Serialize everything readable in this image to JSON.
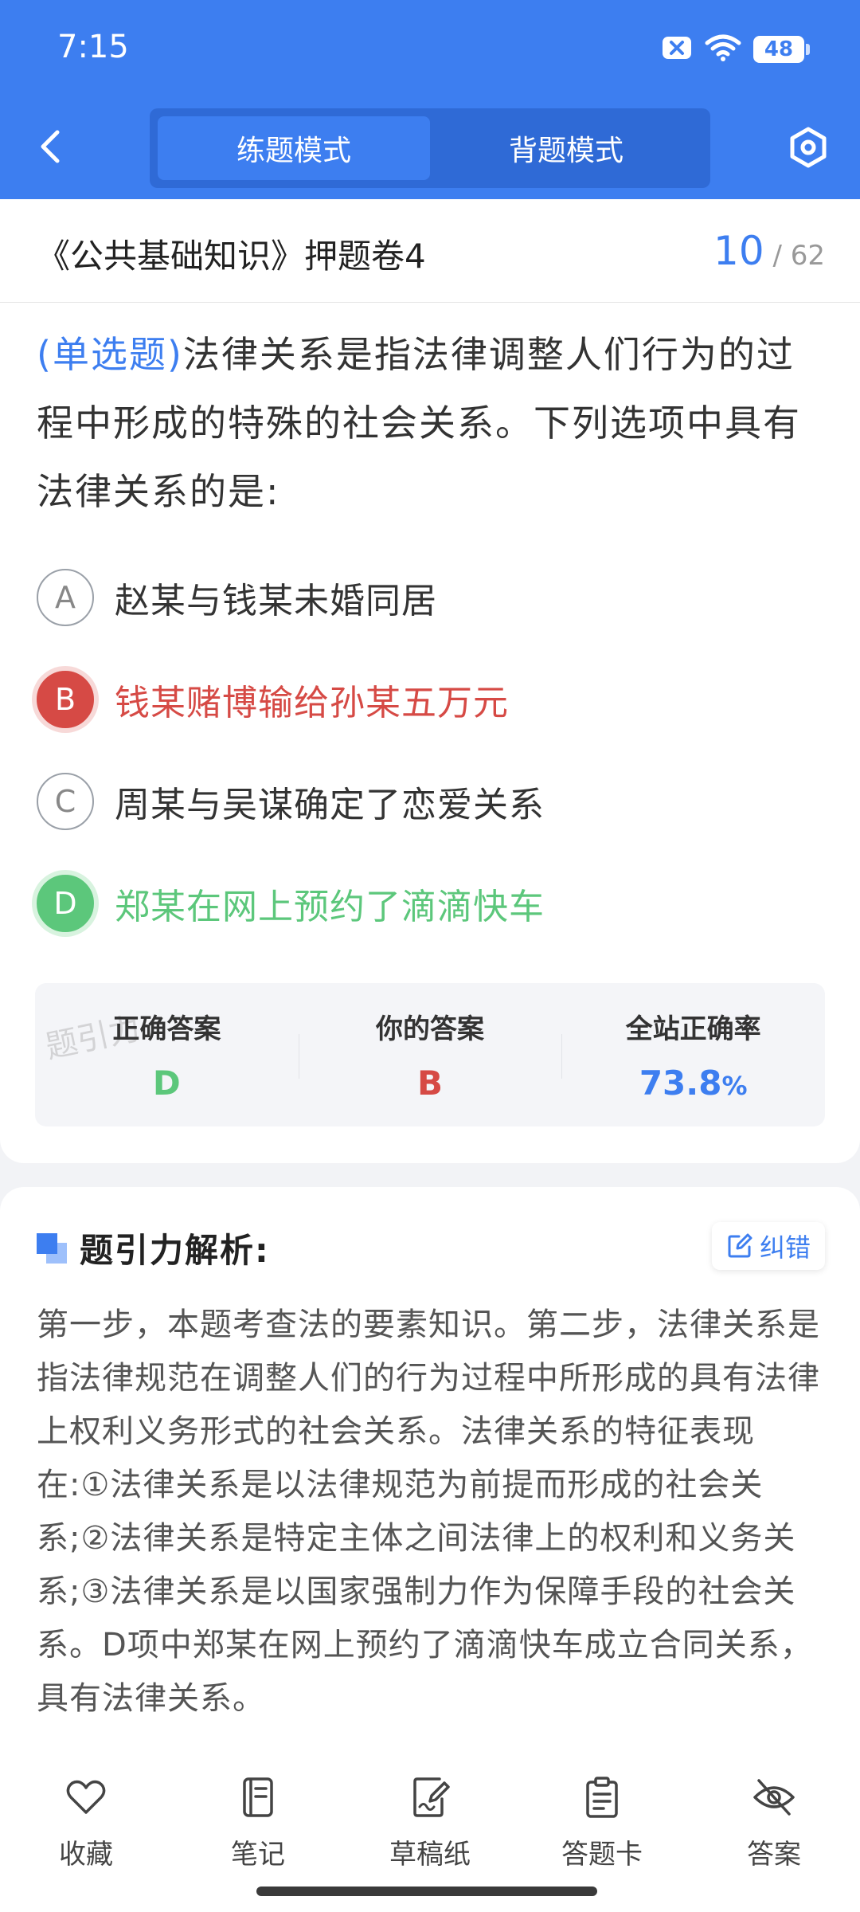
{
  "status": {
    "time": "7:15",
    "battery": "48"
  },
  "header": {
    "modes": [
      "练题模式",
      "背题模式"
    ],
    "active_mode": "练题模式"
  },
  "title_bar": {
    "paper_title": "《公共基础知识》押题卷4",
    "current": "10",
    "separator": "/",
    "total": "62"
  },
  "question": {
    "type": "(单选题)",
    "text": "法律关系是指法律调整人们行为的过程中形成的特殊的社会关系。下列选项中具有法律关系的是:",
    "options": [
      {
        "letter": "A",
        "text": "赵某与钱某未婚同居",
        "state": "normal"
      },
      {
        "letter": "B",
        "text": "钱某赌博输给孙某五万元",
        "state": "wrong"
      },
      {
        "letter": "C",
        "text": "周某与吴谋确定了恋爱关系",
        "state": "normal"
      },
      {
        "letter": "D",
        "text": "郑某在网上预约了滴滴快车",
        "state": "correct"
      }
    ]
  },
  "answers": {
    "correct_label": "正确答案",
    "correct_value": "D",
    "yours_label": "你的答案",
    "yours_value": "B",
    "rate_label": "全站正确率",
    "rate_value": "73.8",
    "rate_unit": "%",
    "watermark": "题引力"
  },
  "analysis": {
    "title": "题引力解析:",
    "report_label": "纠错",
    "text": "第一步，本题考查法的要素知识。第二步，法律关系是指法律规范在调整人们的行为过程中所形成的具有法律上权利义务形式的社会关系。法律关系的特征表现在:①法律关系是以法律规范为前提而形成的社会关系;②法律关系是特定主体之间法律上的权利和义务关系;③法律关系是以国家强制力作为保障手段的社会关系。D项中郑某在网上预约了滴滴快车成立合同关系，具有法律关系。"
  },
  "bottom_nav": {
    "items": [
      {
        "label": "收藏",
        "icon": "heart-icon"
      },
      {
        "label": "笔记",
        "icon": "notebook-icon"
      },
      {
        "label": "草稿纸",
        "icon": "draft-icon"
      },
      {
        "label": "答题卡",
        "icon": "clipboard-icon"
      },
      {
        "label": "答案",
        "icon": "eye-off-icon"
      }
    ]
  },
  "colors": {
    "primary": "#3d7ef0",
    "correct": "#5cc77b",
    "wrong": "#d64a45"
  }
}
